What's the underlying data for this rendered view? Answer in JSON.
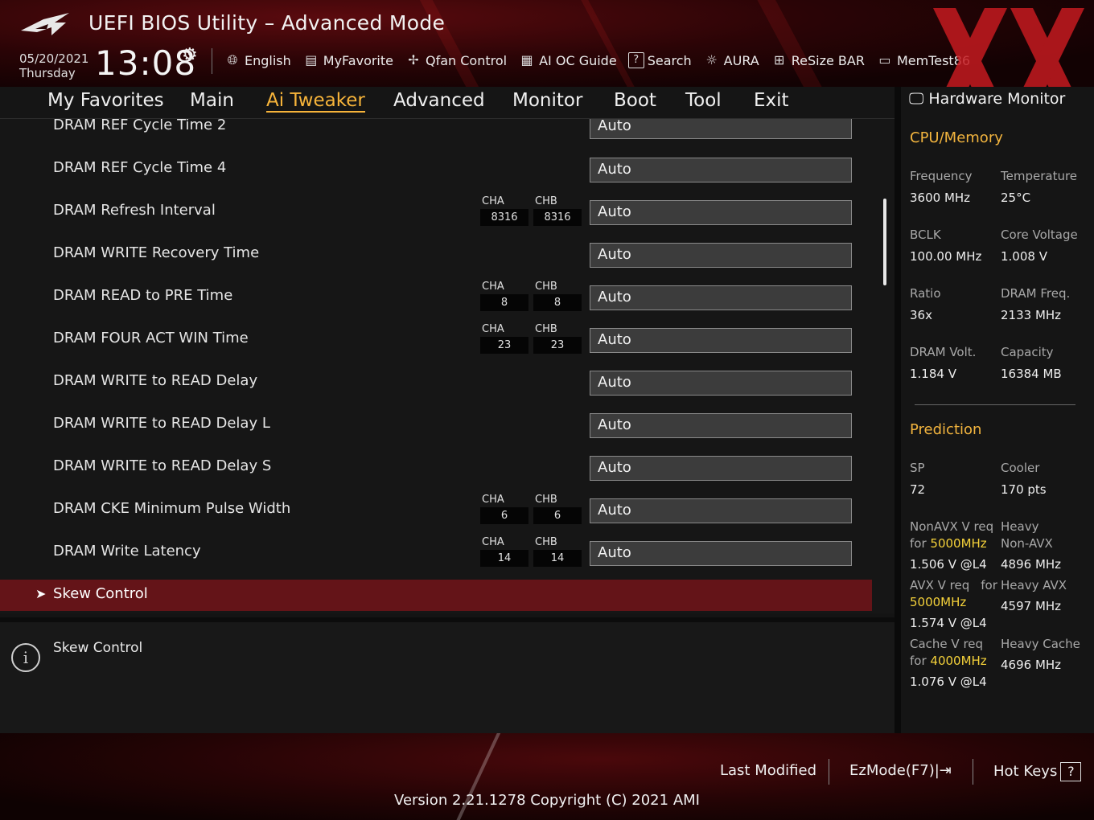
{
  "header": {
    "title": "UEFI BIOS Utility – Advanced Mode",
    "date": "05/20/2021",
    "day": "Thursday",
    "time": "13:08",
    "toolbar": [
      {
        "label": "English",
        "icon": "globe-icon"
      },
      {
        "label": "MyFavorite",
        "icon": "favorite-icon"
      },
      {
        "label": "Qfan Control",
        "icon": "fan-icon"
      },
      {
        "label": "AI OC Guide",
        "icon": "chip-icon"
      },
      {
        "label": "Search",
        "icon": "search-icon"
      },
      {
        "label": "AURA",
        "icon": "aura-icon"
      },
      {
        "label": "ReSize BAR",
        "icon": "resize-bar-icon"
      },
      {
        "label": "MemTest86",
        "icon": "memtest-icon"
      }
    ]
  },
  "nav": {
    "tabs": [
      "My Favorites",
      "Main",
      "Ai Tweaker",
      "Advanced",
      "Monitor",
      "Boot",
      "Tool",
      "Exit"
    ],
    "active": "Ai Tweaker"
  },
  "settings": [
    {
      "label": "DRAM REF Cycle Time 2",
      "value": "Auto"
    },
    {
      "label": "DRAM REF Cycle Time 4",
      "value": "Auto"
    },
    {
      "label": "DRAM Refresh Interval",
      "value": "Auto",
      "cha": "8316",
      "chb": "8316"
    },
    {
      "label": "DRAM WRITE Recovery Time",
      "value": "Auto"
    },
    {
      "label": "DRAM READ to PRE Time",
      "value": "Auto",
      "cha": "8",
      "chb": "8"
    },
    {
      "label": "DRAM FOUR ACT WIN Time",
      "value": "Auto",
      "cha": "23",
      "chb": "23"
    },
    {
      "label": "DRAM WRITE to READ Delay",
      "value": "Auto"
    },
    {
      "label": "DRAM WRITE to READ Delay L",
      "value": "Auto"
    },
    {
      "label": "DRAM WRITE to READ Delay S",
      "value": "Auto"
    },
    {
      "label": "DRAM CKE Minimum Pulse Width",
      "value": "Auto",
      "cha": "6",
      "chb": "6"
    },
    {
      "label": "DRAM Write Latency",
      "value": "Auto",
      "cha": "14",
      "chb": "14"
    }
  ],
  "channel_labels": {
    "a": "CHA",
    "b": "CHB"
  },
  "submenu": {
    "label": "Skew Control"
  },
  "help": {
    "text": "Skew Control"
  },
  "hw_monitor": {
    "title": "Hardware Monitor",
    "cpu_memory": {
      "heading": "CPU/Memory",
      "frequency_label": "Frequency",
      "frequency": "3600 MHz",
      "temperature_label": "Temperature",
      "temperature": "25°C",
      "bclk_label": "BCLK",
      "bclk": "100.00 MHz",
      "core_voltage_label": "Core Voltage",
      "core_voltage": "1.008 V",
      "ratio_label": "Ratio",
      "ratio": "36x",
      "dram_freq_label": "DRAM Freq.",
      "dram_freq": "2133 MHz",
      "dram_volt_label": "DRAM Volt.",
      "dram_volt": "1.184 V",
      "capacity_label": "Capacity",
      "capacity": "16384 MB"
    },
    "prediction": {
      "heading": "Prediction",
      "sp_label": "SP",
      "sp": "72",
      "cooler_label": "Cooler",
      "cooler": "170 pts",
      "nonavx_req_label": "NonAVX V req",
      "for_label": "for",
      "nonavx_freq": "5000MHz",
      "nonavx_v": "1.506 V @L4",
      "heavy_nonavx_label1": "Heavy",
      "heavy_nonavx_label2": "Non-AVX",
      "heavy_nonavx": "4896 MHz",
      "avx_req_label": "AVX V req",
      "avx_for_label": "for",
      "avx_freq": "5000MHz",
      "avx_v": "1.574 V @L4",
      "heavy_avx_label": "Heavy AVX",
      "heavy_avx": "4597 MHz",
      "cache_req_label": "Cache V req",
      "cache_for_label": "for",
      "cache_freq": "4000MHz",
      "cache_v": "1.076 V @L4",
      "heavy_cache_label": "Heavy Cache",
      "heavy_cache": "4696 MHz"
    }
  },
  "footer": {
    "last_modified": "Last Modified",
    "ezmode": "EzMode(F7)|",
    "ezmode_icon": "exit-arrow-icon",
    "hotkeys": "Hot Keys",
    "hotkeys_key": "?",
    "version": "Version 2.21.1278 Copyright (C) 2021 AMI"
  },
  "colors": {
    "accent": "#f7b43a",
    "highlight_row": "#641418",
    "prediction_freq": "#f5d23a"
  }
}
